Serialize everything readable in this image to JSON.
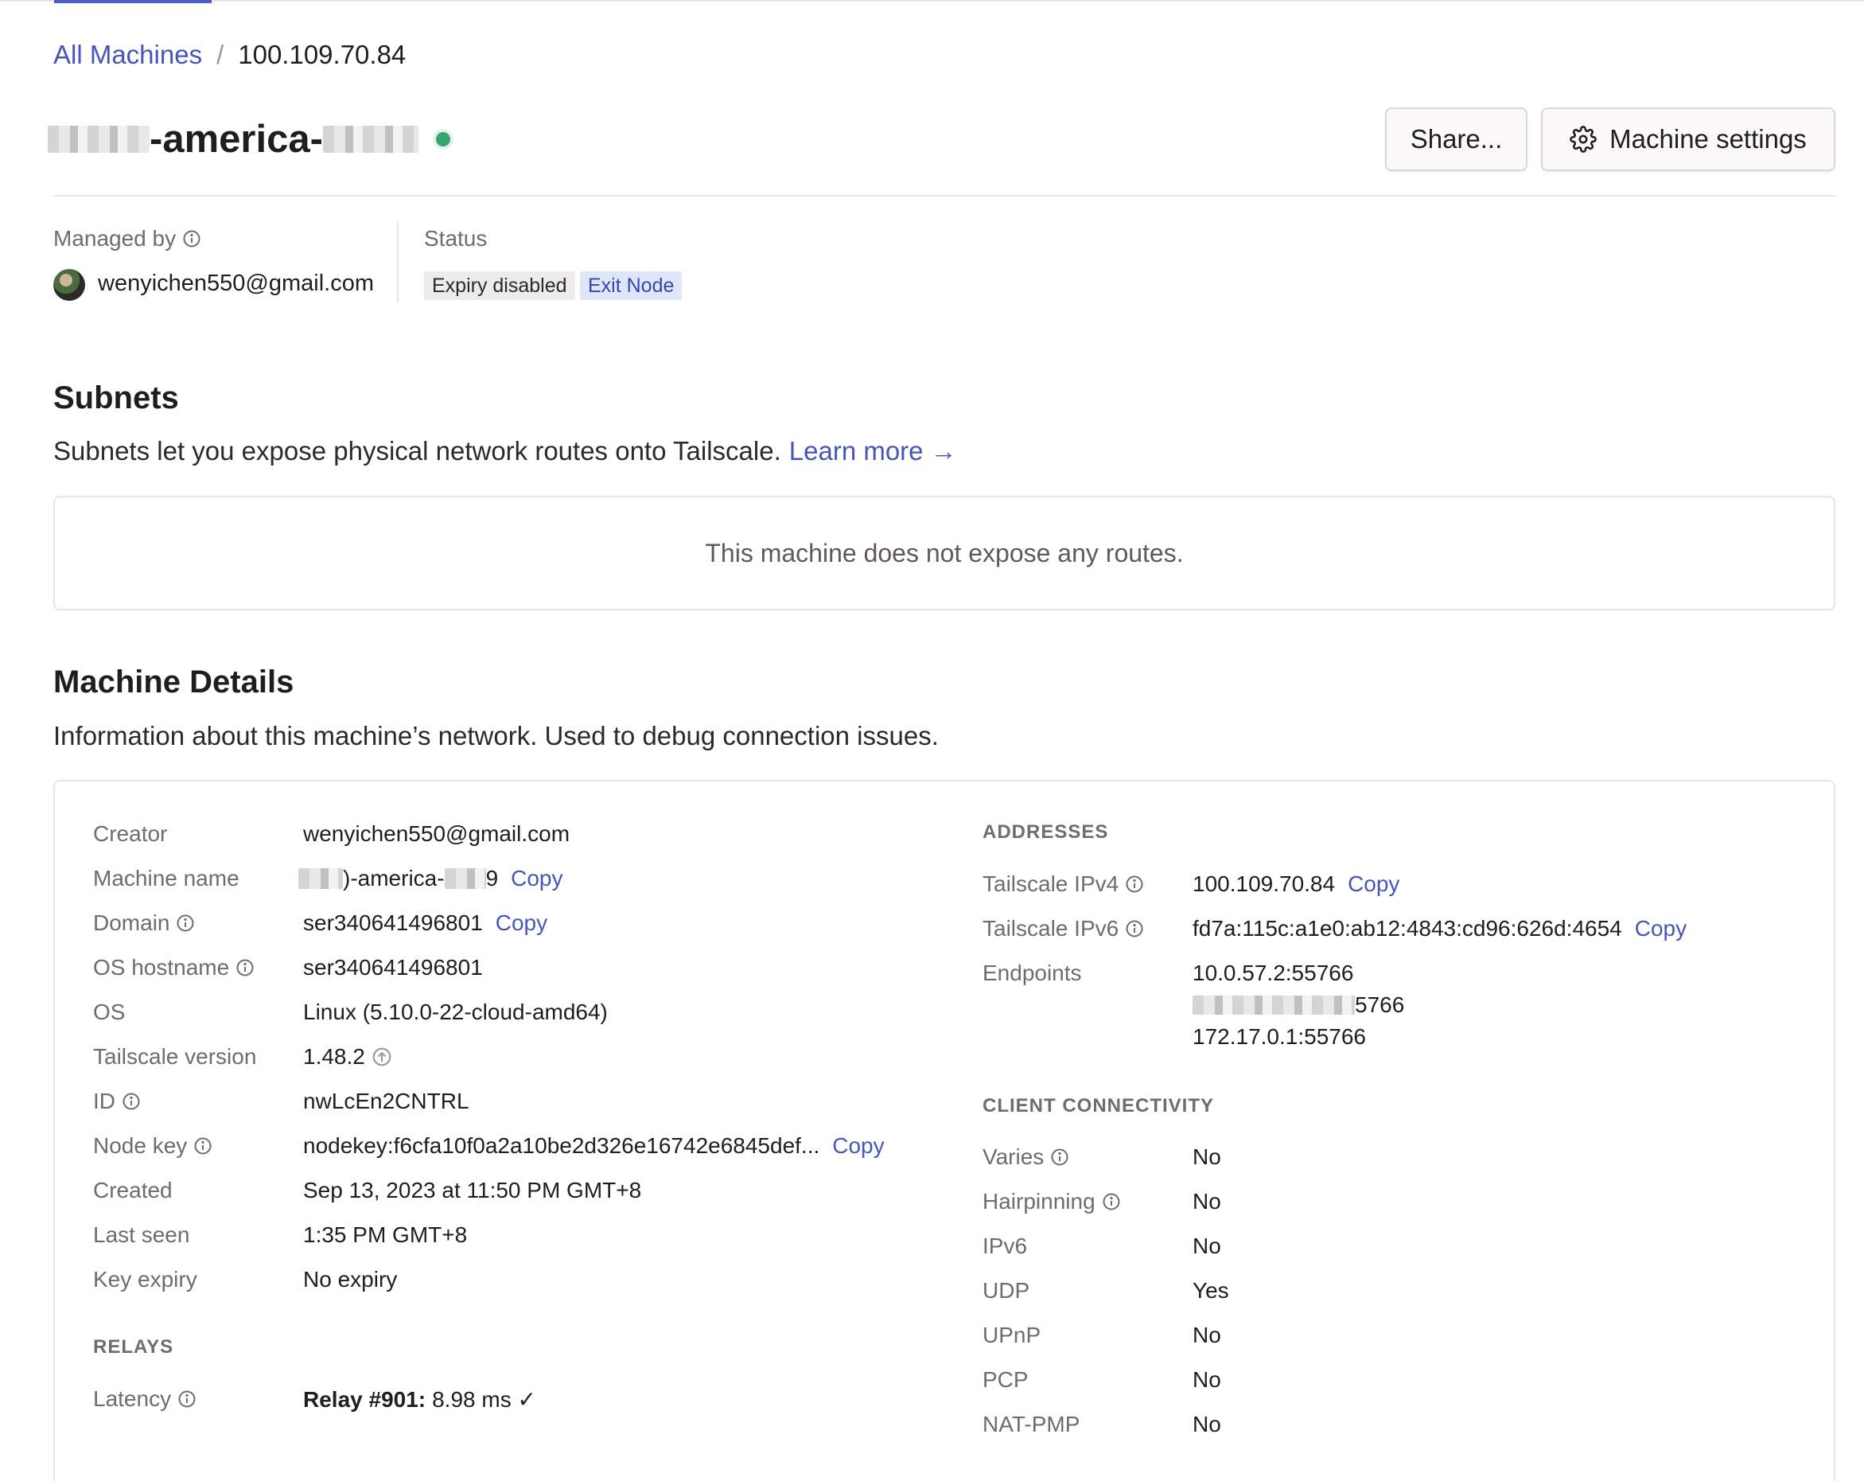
{
  "breadcrumb": {
    "parent": "All Machines",
    "separator": "/",
    "current": "100.109.70.84"
  },
  "header": {
    "title_visible": "-america-",
    "share_label": "Share...",
    "settings_label": "Machine settings",
    "online_color": "#3aa470"
  },
  "meta": {
    "managed_by_label": "Managed by",
    "managed_by_email": "wenyichen550@gmail.com",
    "status_label": "Status",
    "badges": [
      "Expiry disabled",
      "Exit Node"
    ]
  },
  "subnets": {
    "title": "Subnets",
    "description": "Subnets let you expose physical network routes onto Tailscale.",
    "learn_more": "Learn more →",
    "empty_message": "This machine does not expose any routes."
  },
  "details": {
    "title": "Machine Details",
    "description": "Information about this machine’s network. Used to debug connection issues.",
    "copy_label": "Copy",
    "left": {
      "creator": {
        "label": "Creator",
        "value": "wenyichen550@gmail.com"
      },
      "machine_name": {
        "label": "Machine name",
        "value_mid": ")-america-",
        "value_end": "9"
      },
      "domain": {
        "label": "Domain",
        "value": "ser340641496801"
      },
      "os_hostname": {
        "label": "OS hostname",
        "value": "ser340641496801"
      },
      "os": {
        "label": "OS",
        "value": "Linux (5.10.0-22-cloud-amd64)"
      },
      "tailscale_version": {
        "label": "Tailscale version",
        "value": "1.48.2"
      },
      "id": {
        "label": "ID",
        "value": "nwLcEn2CNTRL"
      },
      "node_key": {
        "label": "Node key",
        "value": "nodekey:f6cfa10f0a2a10be2d326e16742e6845def..."
      },
      "created": {
        "label": "Created",
        "value": "Sep 13, 2023 at 11:50 PM GMT+8"
      },
      "last_seen": {
        "label": "Last seen",
        "value": "1:35 PM GMT+8"
      },
      "key_expiry": {
        "label": "Key expiry",
        "value": "No expiry"
      }
    },
    "relays": {
      "title": "RELAYS",
      "latency_label": "Latency",
      "relay_name": "Relay #901:",
      "relay_value": "8.98 ms ✓"
    },
    "addresses": {
      "title": "ADDRESSES",
      "ipv4_label": "Tailscale IPv4",
      "ipv4_value": "100.109.70.84",
      "ipv6_label": "Tailscale IPv6",
      "ipv6_value": "fd7a:115c:a1e0:ab12:4843:cd96:626d:4654",
      "endpoints_label": "Endpoints",
      "endpoint_1": "10.0.57.2:55766",
      "endpoint_2_tail": "5766",
      "endpoint_3": "172.17.0.1:55766"
    },
    "connectivity": {
      "title": "CLIENT CONNECTIVITY",
      "rows": [
        {
          "label": "Varies",
          "value": "No"
        },
        {
          "label": "Hairpinning",
          "value": "No"
        },
        {
          "label": "IPv6",
          "value": "No"
        },
        {
          "label": "UDP",
          "value": "Yes"
        },
        {
          "label": "UPnP",
          "value": "No"
        },
        {
          "label": "PCP",
          "value": "No"
        },
        {
          "label": "NAT-PMP",
          "value": "No"
        }
      ]
    }
  }
}
